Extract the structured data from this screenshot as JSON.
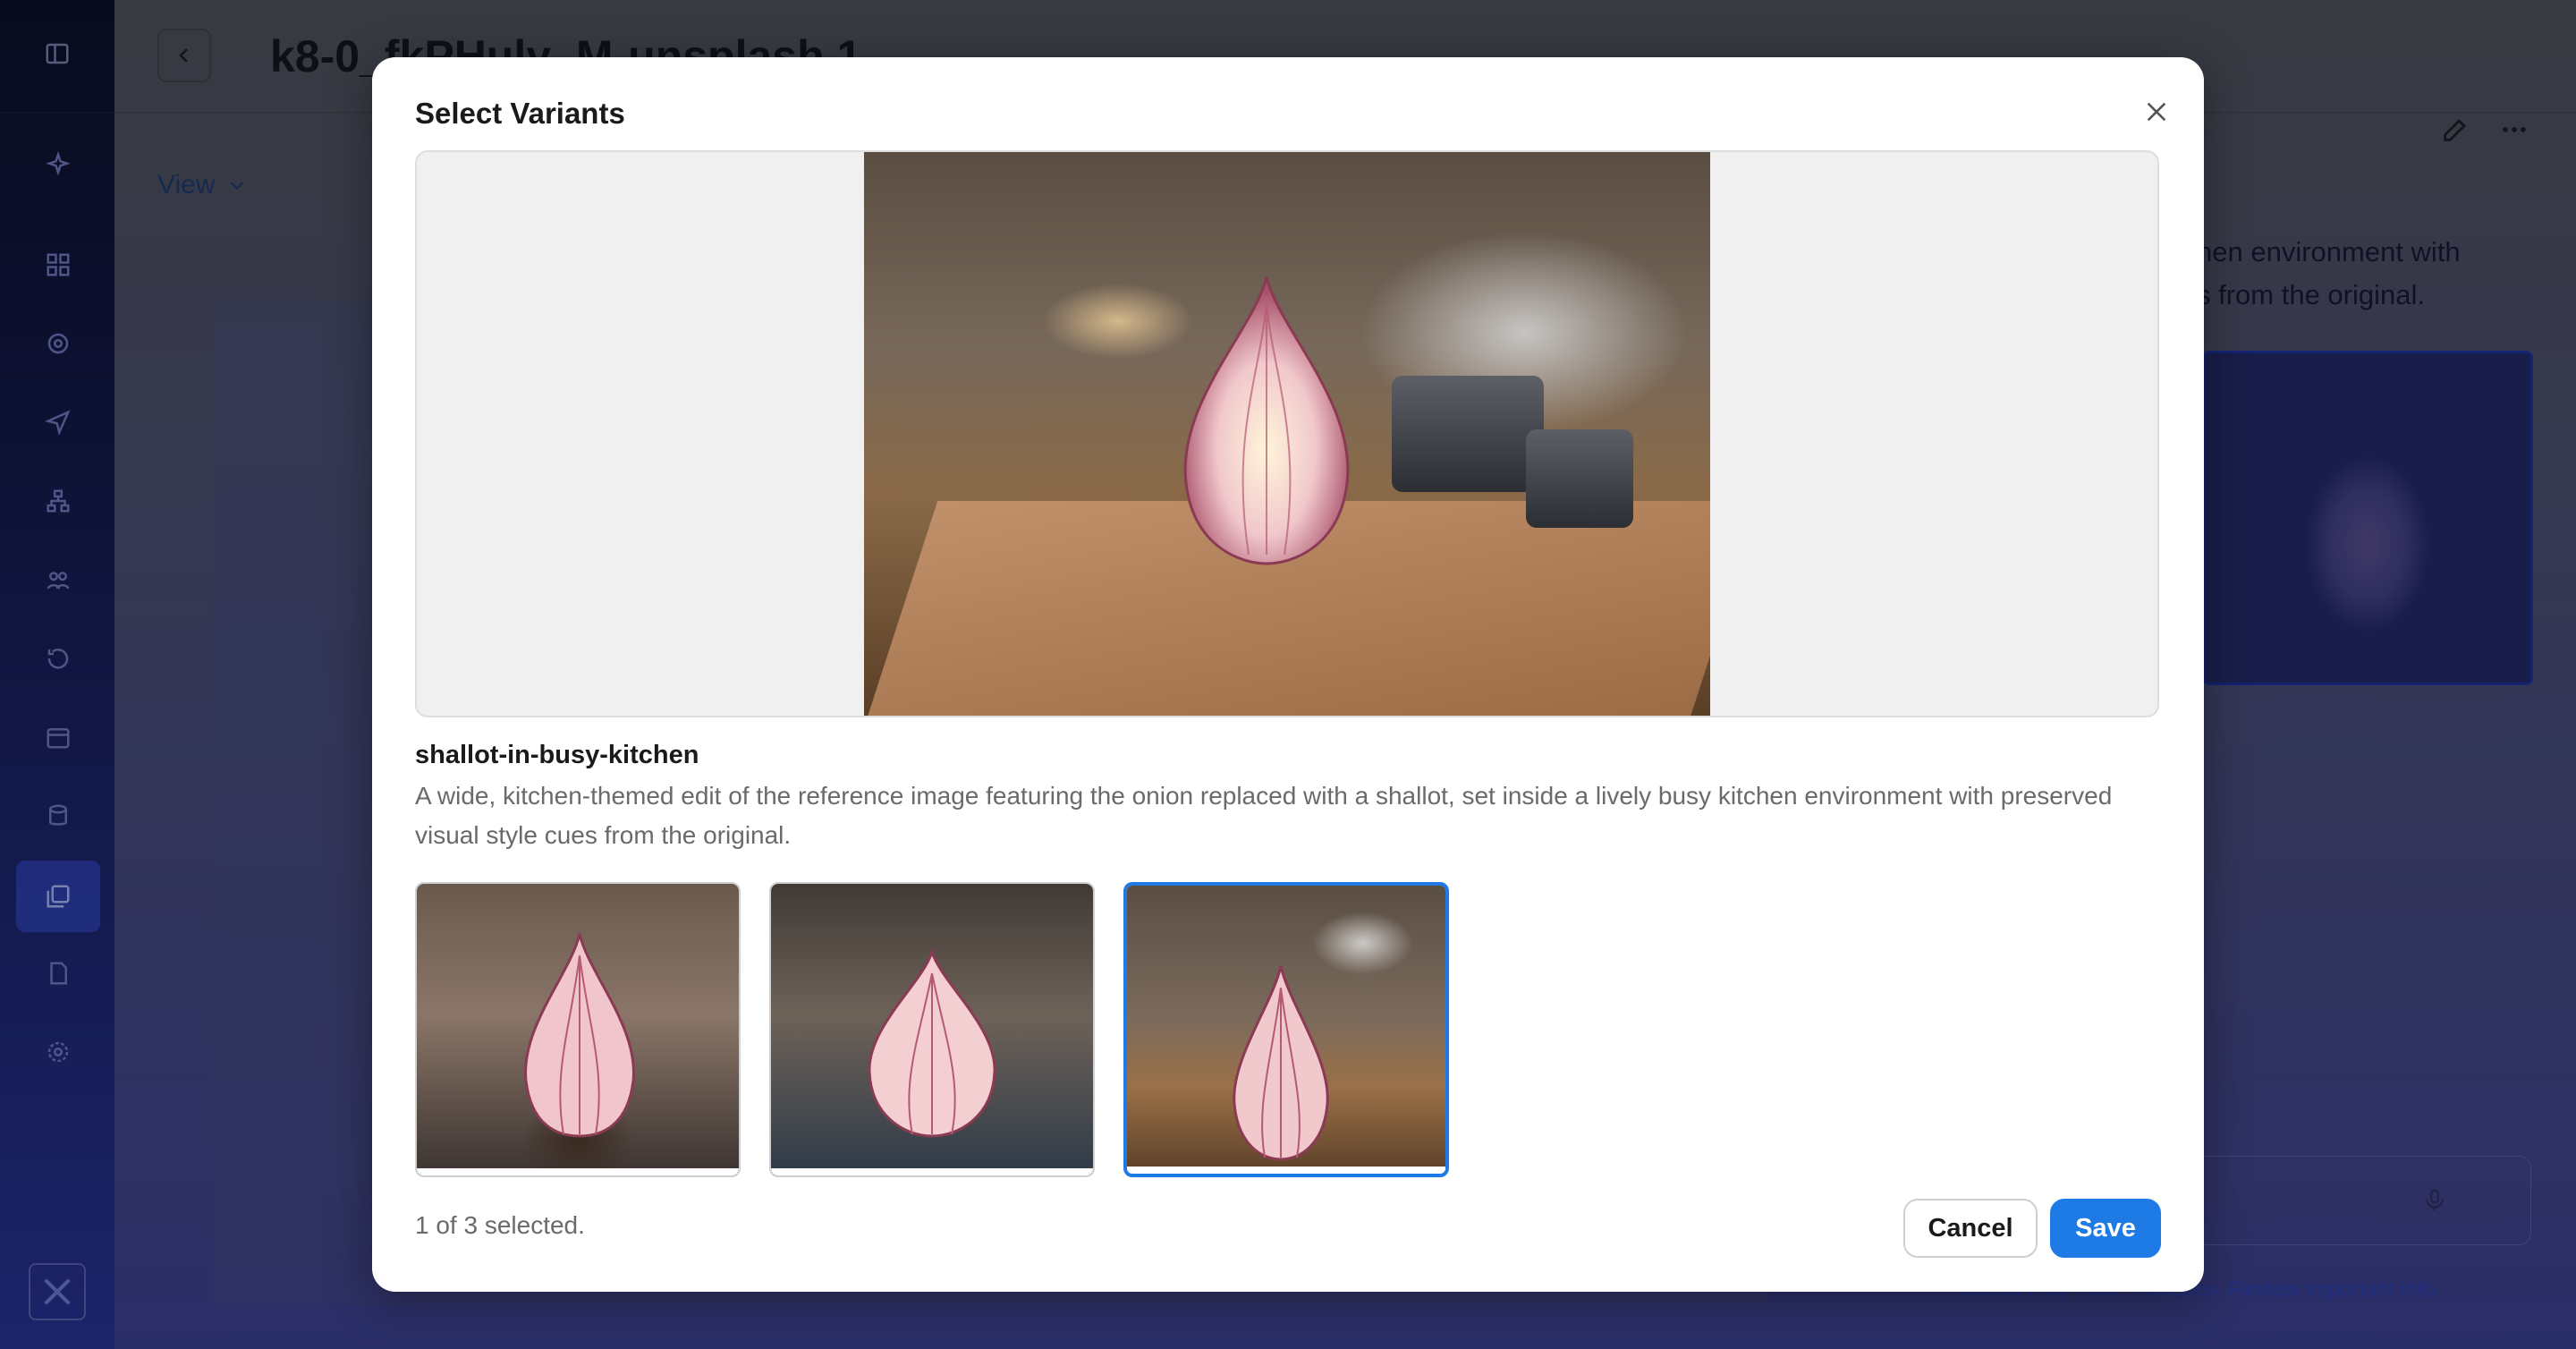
{
  "app": {
    "page_title": "k8-0_fkPHuly_M-unsplash 1",
    "view_label": "View",
    "chat_text_line1": "hen environment with",
    "chat_text_line2": "s from the original.",
    "disclaimer": "Athena may make mistakes. Review important info."
  },
  "modal": {
    "title": "Select Variants",
    "variant_name": "shallot-in-busy-kitchen",
    "variant_description": "A wide, kitchen-themed edit of the reference image featuring the onion replaced with a shallot, set inside a lively busy kitchen environment with preserved visual style cues from the original.",
    "selection_status": "1 of 3 selected.",
    "cancel_label": "Cancel",
    "save_label": "Save",
    "variants": [
      {
        "selected": false
      },
      {
        "selected": false
      },
      {
        "selected": true
      }
    ]
  },
  "colors": {
    "accent": "#1e7be6",
    "sidebar_active": "#3246be"
  },
  "icons": [
    "sidebar-toggle-icon",
    "sparkle-icon",
    "dashboard-icon",
    "target-icon",
    "send-icon",
    "hierarchy-icon",
    "people-icon",
    "history-icon",
    "calendar-icon",
    "database-icon",
    "gallery-icon",
    "document-icon",
    "gear-icon",
    "chevron-left-icon",
    "chevron-down-icon",
    "edit-icon",
    "more-icon",
    "close-icon",
    "microphone-icon"
  ]
}
